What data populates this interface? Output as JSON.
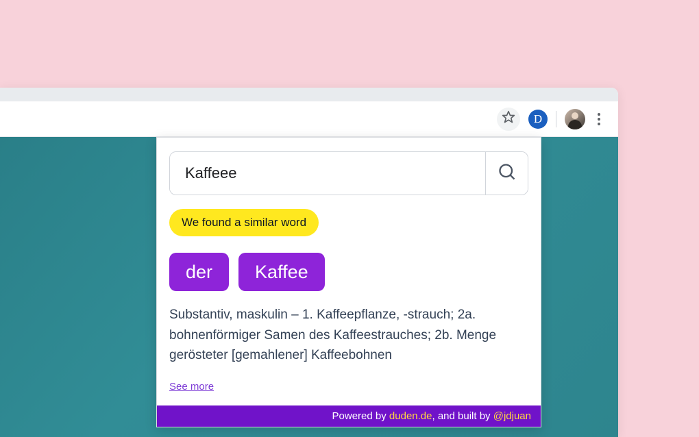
{
  "toolbar": {
    "extension_letter": "D"
  },
  "popup": {
    "search_value": "Kaffeee",
    "notice": "We found a similar word",
    "article": "der",
    "word": "Kaffee",
    "definition": "Substantiv, maskulin – 1. Kaffeepflanze, -strauch; 2a. bohnenförmiger Samen des Kaffeestrauches; 2b. Menge gerösteter [gemahlener] Kaffeebohnen",
    "see_more": "See more"
  },
  "footer": {
    "text_prefix": "Powered by ",
    "link1": "duden.de",
    "text_mid": ", and built by ",
    "link2": "@jdjuan"
  }
}
